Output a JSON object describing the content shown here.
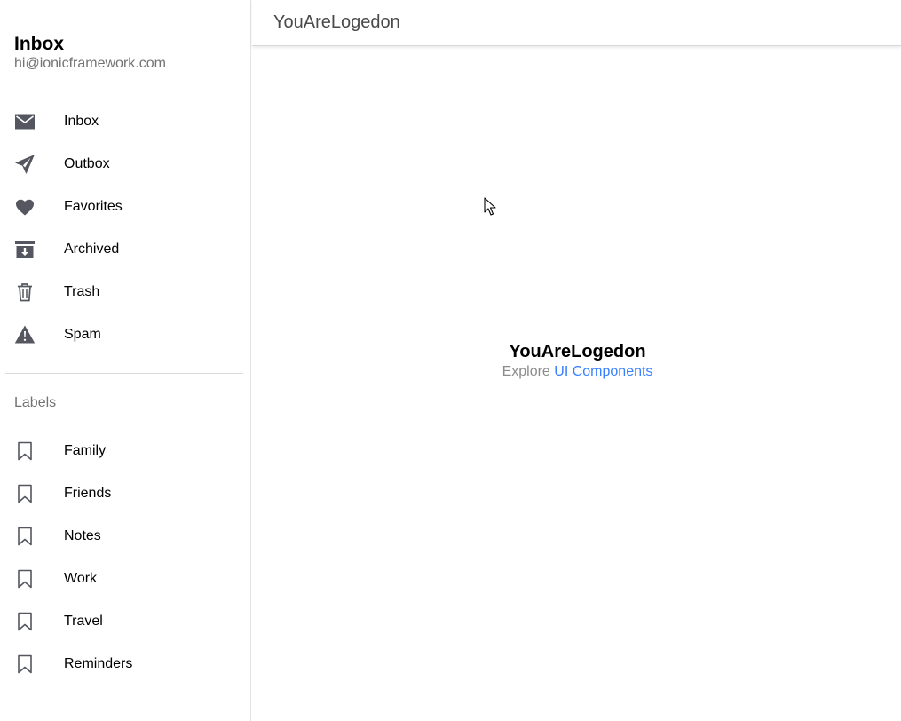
{
  "menu": {
    "title": "Inbox",
    "subtitle": "hi@ionicframework.com",
    "items": [
      {
        "label": "Inbox",
        "icon": "mail-icon"
      },
      {
        "label": "Outbox",
        "icon": "paper-plane-icon"
      },
      {
        "label": "Favorites",
        "icon": "heart-icon"
      },
      {
        "label": "Archived",
        "icon": "archive-icon"
      },
      {
        "label": "Trash",
        "icon": "trash-icon"
      },
      {
        "label": "Spam",
        "icon": "warning-icon"
      }
    ],
    "labels_header": "Labels",
    "labels": [
      {
        "label": "Family",
        "icon": "bookmark-icon"
      },
      {
        "label": "Friends",
        "icon": "bookmark-icon"
      },
      {
        "label": "Notes",
        "icon": "bookmark-icon"
      },
      {
        "label": "Work",
        "icon": "bookmark-icon"
      },
      {
        "label": "Travel",
        "icon": "bookmark-icon"
      },
      {
        "label": "Reminders",
        "icon": "bookmark-icon"
      }
    ]
  },
  "toolbar": {
    "title": "YouAreLogedon"
  },
  "content": {
    "title": "YouAreLogedon",
    "explore_text": "Explore",
    "link_text": "UI Components"
  },
  "colors": {
    "icon": "#54575f",
    "link": "#3880ff",
    "muted": "#737373"
  }
}
